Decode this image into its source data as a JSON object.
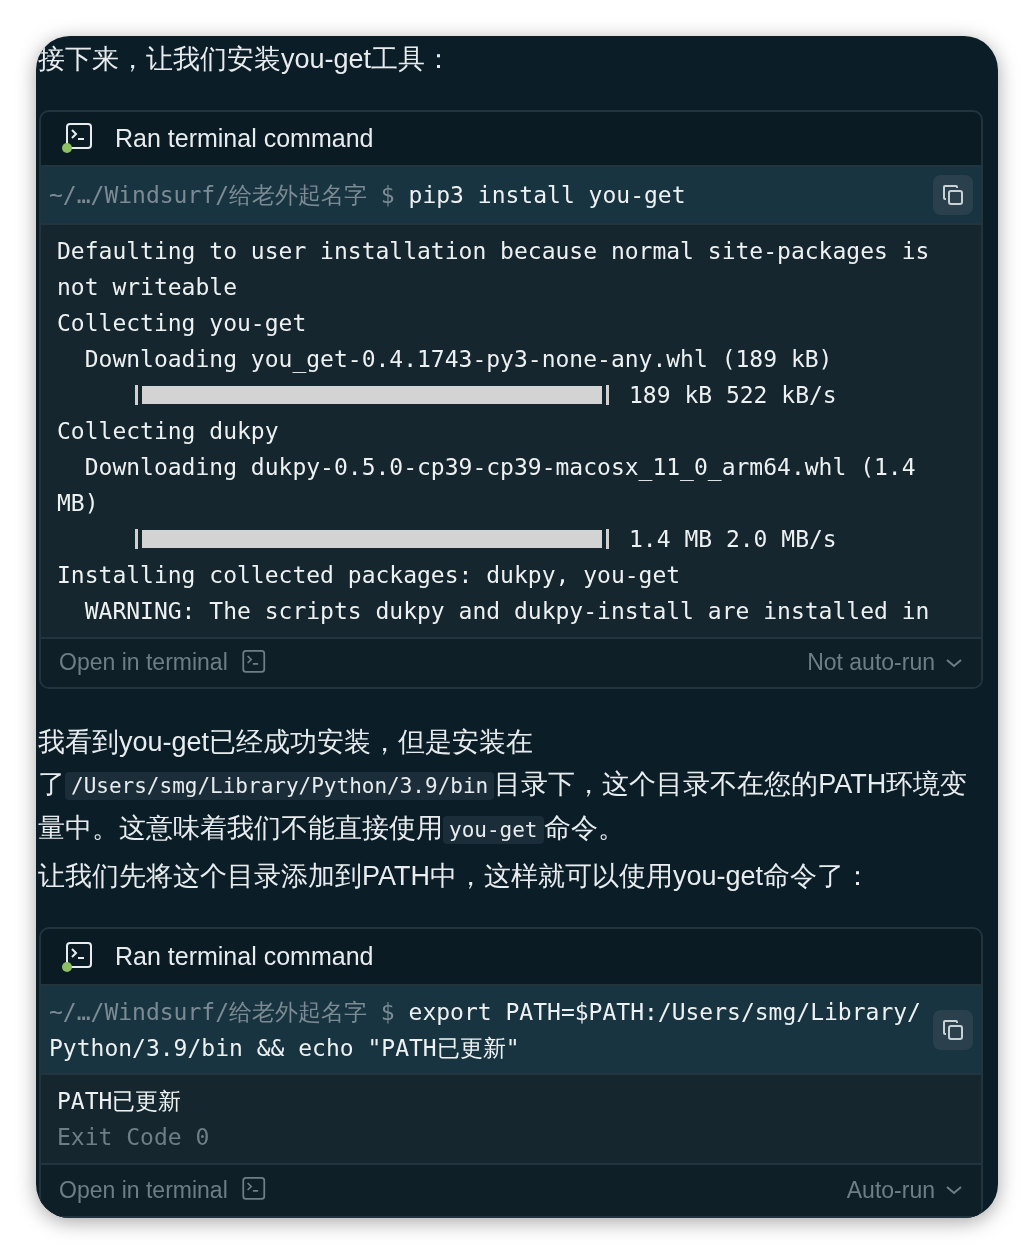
{
  "blocks": [
    {
      "kind": "paragraph",
      "lines": [
        [
          {
            "kind": "text",
            "text": "接下来，让我们安装you-get工具："
          }
        ]
      ]
    },
    {
      "kind": "terminal",
      "title": "Ran terminal command",
      "prompt": "~/…/Windsurf/给老外起名字 $",
      "command": "pip3 install you-get",
      "output": [
        {
          "kind": "line",
          "text": "Defaulting to user installation because normal site-packages is"
        },
        {
          "kind": "line",
          "text": "not writeable"
        },
        {
          "kind": "line",
          "text": "Collecting you-get"
        },
        {
          "kind": "line",
          "text": "  Downloading you_get-0.4.1743-py3-none-any.whl (189 kB)"
        },
        {
          "kind": "progress",
          "reading": "189 kB 522 kB/s"
        },
        {
          "kind": "line",
          "text": "Collecting dukpy"
        },
        {
          "kind": "line",
          "text": "  Downloading dukpy-0.5.0-cp39-cp39-macosx_11_0_arm64.whl (1.4"
        },
        {
          "kind": "line",
          "text": "MB)"
        },
        {
          "kind": "progress",
          "reading": "1.4 MB 2.0 MB/s"
        },
        {
          "kind": "line",
          "text": "Installing collected packages: dukpy, you-get"
        },
        {
          "kind": "line",
          "text": "  WARNING: The scripts dukpy and dukpy-install are installed in"
        }
      ],
      "open_label": "Open in terminal",
      "run_mode": "Not auto-run"
    },
    {
      "kind": "paragraph",
      "lines": [
        [
          {
            "kind": "text",
            "text": "我看到you-get已经成功安装，但是安装在"
          }
        ],
        [
          {
            "kind": "text",
            "text": "了"
          },
          {
            "kind": "code",
            "text": "/Users/smg/Library/Python/3.9/bin"
          },
          {
            "kind": "text",
            "text": "目录下，这个目录不在您的PATH环境变"
          }
        ],
        [
          {
            "kind": "text",
            "text": "量中。这意味着我们不能直接使用"
          },
          {
            "kind": "code",
            "text": "you-get"
          },
          {
            "kind": "text",
            "text": "命令。"
          }
        ]
      ]
    },
    {
      "kind": "paragraph",
      "lines": [
        [
          {
            "kind": "text",
            "text": "让我们先将这个目录添加到PATH中，这样就可以使用you-get命令了："
          }
        ]
      ]
    },
    {
      "kind": "terminal",
      "title": "Ran terminal command",
      "prompt": "~/…/Windsurf/给老外起名字 $",
      "command": "export PATH=$PATH:/Users/smg/Library/Python/3.9/bin && echo \"PATH已更新\"",
      "output": [
        {
          "kind": "line",
          "text": "PATH已更新"
        },
        {
          "kind": "exit",
          "text": "Exit Code 0"
        }
      ],
      "open_label": "Open in terminal",
      "run_mode": "Auto-run"
    }
  ]
}
